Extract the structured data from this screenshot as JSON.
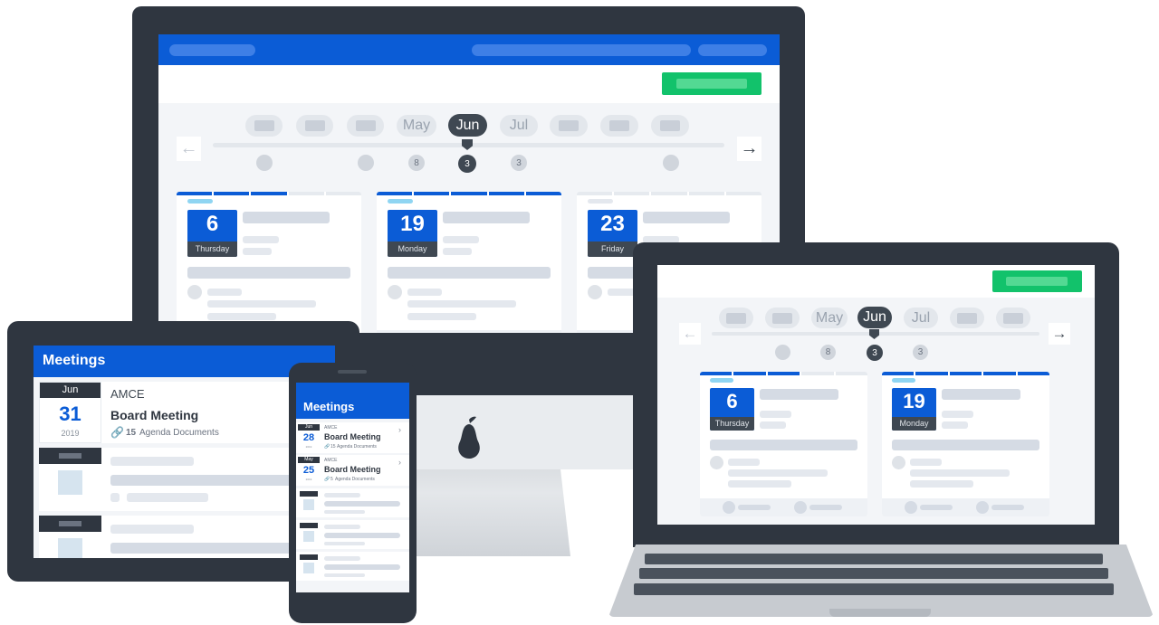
{
  "colors": {
    "brand_blue": "#0b5cd6",
    "action_green": "#12c26b",
    "device_dark": "#2f3640",
    "pill_active": "#3f4852",
    "background": "#ffffff"
  },
  "timeline": {
    "months": [
      "May",
      "Jun",
      "Jul"
    ],
    "selected_month": "Jun",
    "badges": [
      "8",
      "3",
      "3"
    ],
    "prev_icon": "arrow-left-icon",
    "next_icon": "arrow-right-icon"
  },
  "desktop": {
    "meetings": [
      {
        "date": "6",
        "weekday": "Thursday"
      },
      {
        "date": "19",
        "weekday": "Monday"
      },
      {
        "date": "23",
        "weekday": "Friday"
      }
    ]
  },
  "laptop": {
    "meetings": [
      {
        "date": "6",
        "weekday": "Thursday"
      },
      {
        "date": "19",
        "weekday": "Monday"
      }
    ]
  },
  "tablet": {
    "header": "Meetings",
    "meeting": {
      "month": "Jun",
      "day": "31",
      "year": "2019",
      "org": "AMCE",
      "title": "Board Meeting",
      "docs_count": "15",
      "docs_label": "Agenda Documents"
    }
  },
  "phone": {
    "header": "Meetings",
    "meetings": [
      {
        "month": "Jun",
        "day": "28",
        "year": "2019",
        "org": "AMCE",
        "title": "Board Meeting",
        "docs_count": "15",
        "docs_label": "Agenda Documents"
      },
      {
        "month": "May",
        "day": "25",
        "year": "2019",
        "org": "AMCE",
        "title": "Board Meeting",
        "docs_count": "5",
        "docs_label": "Agenda Documents"
      }
    ]
  },
  "logo_icon": "pear-icon"
}
